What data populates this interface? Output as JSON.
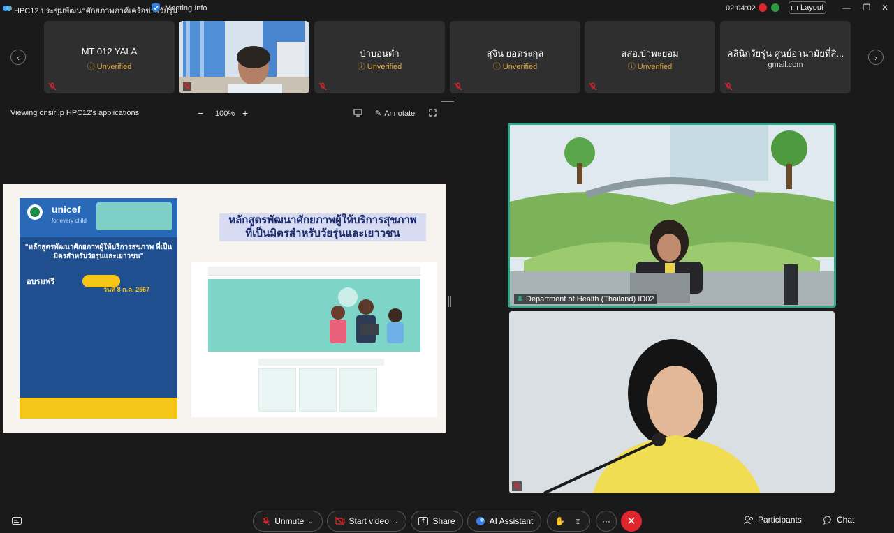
{
  "window": {
    "title": "HPC12 ประชุมพัฒนาศักยภาพภาคีเครือข่ายวัยรุ่น",
    "meeting_info": "Meeting Info",
    "clock": "02:04:02",
    "layout_label": "Layout",
    "minimize": "—",
    "restore": "❐",
    "close": "✕"
  },
  "participants": [
    {
      "name": "MT 012 YALA",
      "status": "Unverified",
      "status_icon": "warning-icon"
    },
    {
      "name": "",
      "status": "",
      "video": true
    },
    {
      "name": "ป่าบอนต่ำ",
      "status": "Unverified",
      "status_icon": "warning-icon"
    },
    {
      "name": "สุจิน ยอดระกุล",
      "status": "Unverified",
      "status_icon": "warning-icon"
    },
    {
      "name": "สสอ.ป่าพะยอม",
      "status": "Unverified",
      "status_icon": "warning-icon"
    },
    {
      "name": "คลินิกวัยรุ่น ศูนย์อานามัยที่สิ...",
      "status": "gmail.com"
    }
  ],
  "share_toolbar": {
    "viewing": "Viewing onsiri.p HPC12's applications",
    "zoom_out": "−",
    "zoom": "100%",
    "zoom_in": "+",
    "annotate": "Annotate"
  },
  "shared_content": {
    "course_title_line1": "หลักสูตรพัฒนาศักยภาพผู้ให้บริการสุขภาพ",
    "course_title_line2": "ที่เป็นมิตรสำหรับวัยรุ่นและเยาวชน",
    "poster_brand": "unicef",
    "poster_tagline": "for every child",
    "poster_heading": "\"หลักสูตรพัฒนาศักยภาพผู้ให้บริการสุขภาพ ที่เป็นมิตรสำหรับวัยรุ่นและเยาวชน\"",
    "poster_free": "อบรมฟรี",
    "poster_date": "วันที่ 8 ก.ค. 2567"
  },
  "videos": {
    "top_label": "Department of Health (Thailand) ID02"
  },
  "toolbar": {
    "unmute": "Unmute",
    "start_video": "Start video",
    "share": "Share",
    "ai_assistant": "AI Assistant",
    "more": "···",
    "participants": "Participants",
    "chat": "Chat"
  },
  "colors": {
    "accent_red": "#e0262d",
    "unverified": "#e0a43a",
    "active_speaker": "#2fa98a"
  }
}
